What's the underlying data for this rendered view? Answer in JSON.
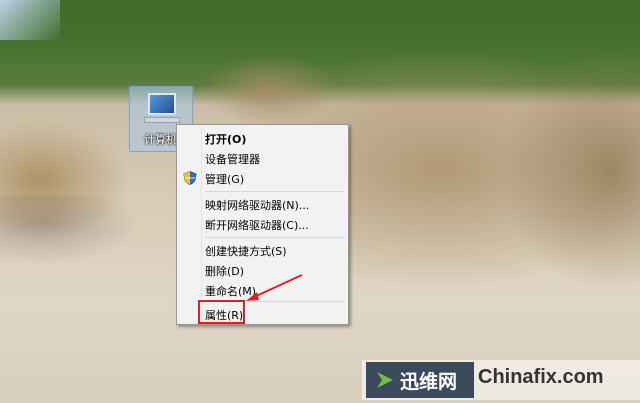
{
  "desktop": {
    "icon_label": "计算机"
  },
  "context_menu": {
    "items": [
      {
        "label": "打开(O)",
        "bold": true
      },
      {
        "label": "设备管理器"
      },
      {
        "label": "管理(G)",
        "icon": "shield-icon"
      },
      {
        "label": "映射网络驱动器(N)..."
      },
      {
        "label": "断开网络驱动器(C)..."
      },
      {
        "label": "创建快捷方式(S)"
      },
      {
        "label": "删除(D)"
      },
      {
        "label": "重命名(M)"
      },
      {
        "label": "属性(R)"
      }
    ]
  },
  "annotation": {
    "highlight_color": "#e02020"
  },
  "watermark": {
    "brand_cn": "迅维网",
    "domain": "Chinafix.com",
    "accent": "#3b4a5a"
  }
}
